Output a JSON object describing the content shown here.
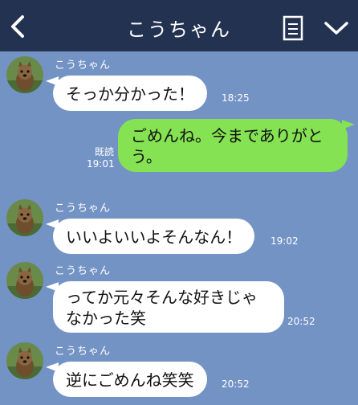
{
  "header": {
    "title": "こうちゃん",
    "back_icon": "chevron-left-icon",
    "memo_icon": "note-list-icon",
    "menu_icon": "chevron-down-icon",
    "background": "#243252"
  },
  "chat": {
    "background": "#7393c4",
    "messages": [
      {
        "sender": "こうちゃん",
        "text": "そっか分かった！",
        "time": "18:25",
        "direction": "incoming"
      },
      {
        "text": "ごめんね。今までありがと",
        "text2": "う。",
        "time": "19:01",
        "read": "既読",
        "direction": "outgoing"
      },
      {
        "sender": "こうちゃん",
        "text": "いいよいいよそんなん！",
        "time": "19:02",
        "direction": "incoming"
      },
      {
        "sender": "こうちゃん",
        "text": "ってか元々そんな好きじゃ",
        "text2": "なかった笑",
        "time": "20:52",
        "direction": "incoming"
      },
      {
        "sender": "こうちゃん",
        "text": "逆にごめんね笑笑",
        "time": "20:52",
        "direction": "incoming"
      }
    ]
  },
  "colors": {
    "incoming_bubble": "#ffffff",
    "outgoing_bubble": "#84e253",
    "header": "#243252"
  }
}
